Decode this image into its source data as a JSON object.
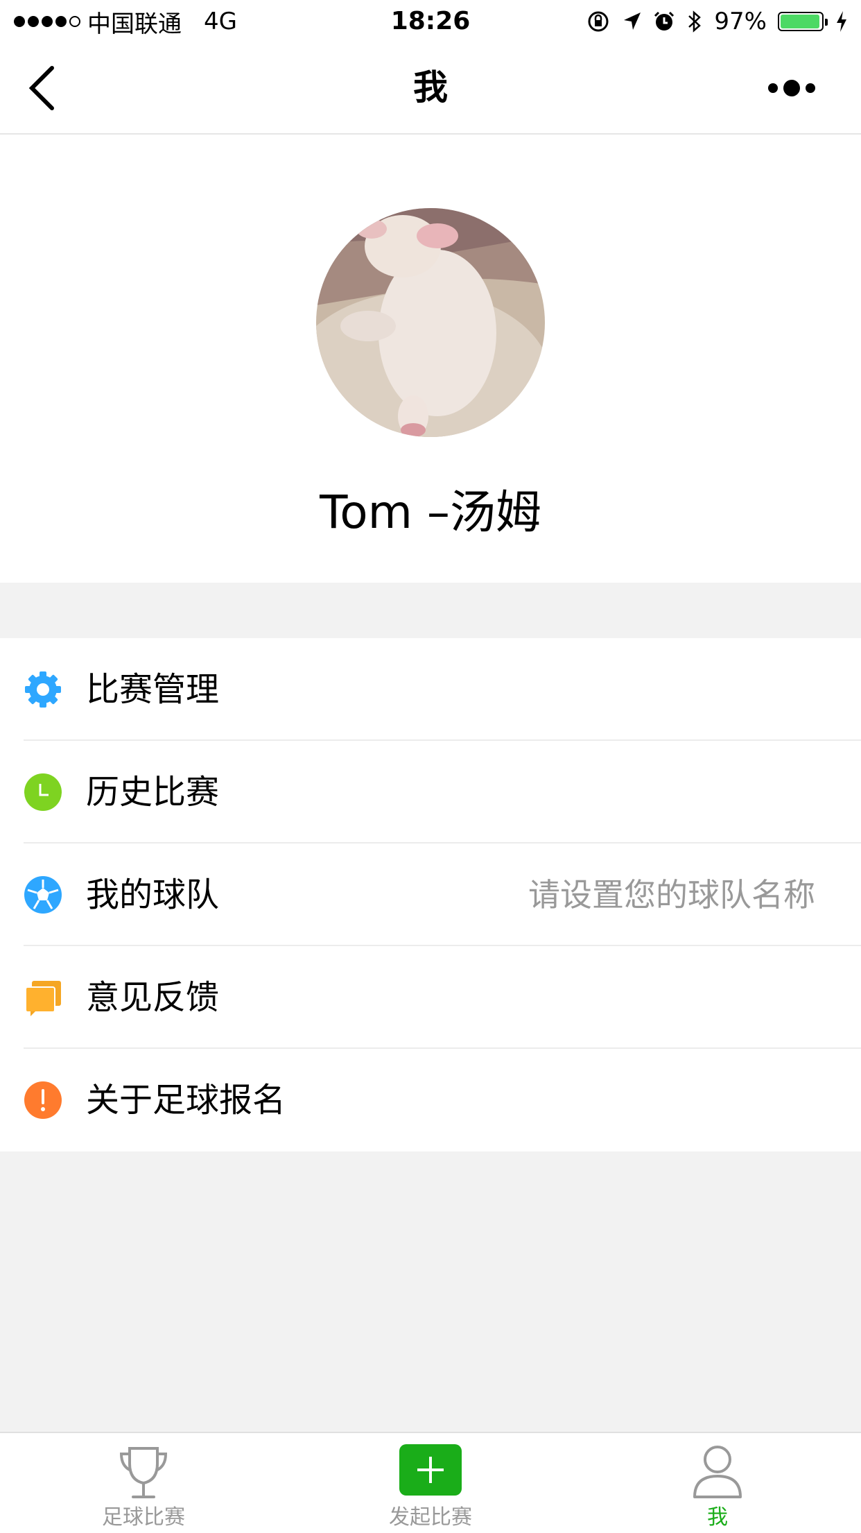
{
  "status_bar": {
    "carrier": "中国联通",
    "network": "4G",
    "time": "18:26",
    "battery": "97%",
    "battery_level": 0.97
  },
  "nav": {
    "title": "我",
    "back_icon": "chevron-left-icon",
    "more_icon": "more-dots-icon"
  },
  "profile": {
    "avatar": "avatar-photo",
    "name": "Tom –汤姆"
  },
  "menu": {
    "items": [
      {
        "label": "比赛管理",
        "icon": "gear-icon",
        "color": "#2ea7ff"
      },
      {
        "label": "历史比赛",
        "icon": "clock-icon",
        "color": "#7ed321"
      },
      {
        "label": "我的球队",
        "icon": "soccer-ball-icon",
        "color": "#2ea7ff",
        "value": "请设置您的球队名称"
      },
      {
        "label": "意见反馈",
        "icon": "feedback-icon",
        "color": "#f5a623"
      },
      {
        "label": "关于足球报名",
        "icon": "info-alert-icon",
        "color": "#ff7b2e"
      }
    ]
  },
  "tabbar": {
    "tabs": [
      {
        "label": "足球比赛",
        "icon": "trophy-icon",
        "active": false
      },
      {
        "label": "发起比赛",
        "icon": "plus-icon",
        "active": false
      },
      {
        "label": "我",
        "icon": "user-icon",
        "active": true
      }
    ],
    "active_color": "#1aad19"
  }
}
